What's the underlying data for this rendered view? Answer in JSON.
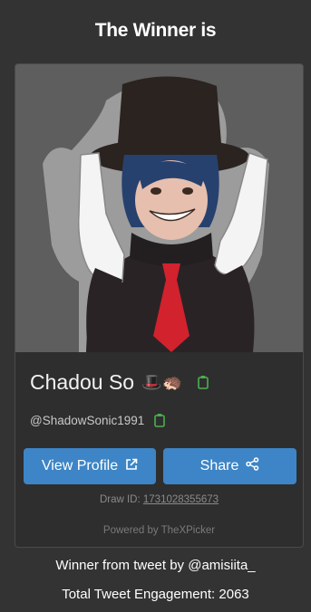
{
  "header": {
    "title": "The Winner is"
  },
  "winner": {
    "name": "Chadou So",
    "name_emojis": "🎩🦔",
    "handle": "@ShadowSonic1991",
    "avatar_alt": "winner-avatar"
  },
  "actions": {
    "view_profile_label": "View Profile",
    "share_label": "Share"
  },
  "draw": {
    "label": "Draw ID:",
    "id": "1731028355673"
  },
  "powered_by": "Powered by TheXPicker",
  "footer": {
    "tweet_line": "Winner from tweet by @amisiita_",
    "engagement_line": "Total Tweet Engagement: 2063"
  },
  "colors": {
    "background": "#333333",
    "button": "#3d85c6",
    "copy_icon": "#4caf50"
  }
}
